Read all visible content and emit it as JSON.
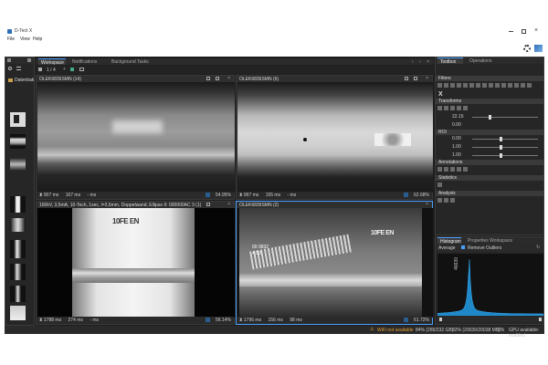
{
  "app": {
    "title": "D-Tect X"
  },
  "menu": [
    "File",
    "View",
    "Help"
  ],
  "left_panel": {
    "tab_label": "Datenbak"
  },
  "top_tabs": [
    {
      "label": "Workspace",
      "active": true
    },
    {
      "label": "Notifications",
      "active": false
    },
    {
      "label": "Background Tasks",
      "active": false
    }
  ],
  "toolbar_counter": "1 / 4",
  "viewports": [
    {
      "title": "OLEK6836SMN (14)",
      "footer": [
        "907 ms",
        "167 ms",
        "- ms"
      ],
      "zoom": "54.95%"
    },
    {
      "title": "OLEK6836SMN (6)",
      "footer": [
        "997 ms",
        "155 ms",
        "- ms"
      ],
      "zoom": "62.68%"
    },
    {
      "title": "160kV, 3,5mA, 10-Tech, 1sec, l=3,6mm, Doppelwand, Ellipse II: 000000AC 3 (1)",
      "footer": [
        "1788 ms",
        "274 ms",
        "- ms"
      ],
      "zoom": "56.14%"
    },
    {
      "title": "OLEK6836SMN (2)",
      "footer": [
        "1796 ms",
        "156 ms",
        "98 ms"
      ],
      "zoom": "61.72%"
    }
  ],
  "image_texts": {
    "iqi_a": "10FE EN",
    "iqi_b": "10FE EN",
    "ruler": [
      "00 9832",
      "4.50"
    ]
  },
  "right_tabs": [
    {
      "label": "Toolbox",
      "active": true
    },
    {
      "label": "Operations",
      "active": false
    }
  ],
  "sections": {
    "filters": "Filters",
    "transforms": "Transforms",
    "roi": "ROI",
    "annotations": "Annotations",
    "statistics": "Statistics",
    "analysis": "Analysis"
  },
  "transform_values": [
    "22.15",
    "0.00"
  ],
  "roi_values": [
    "0.00",
    "1.00",
    "1.00"
  ],
  "histogram": {
    "tabs": [
      {
        "label": "Histogram",
        "active": true
      },
      {
        "label": "Properties Workspace",
        "active": false
      }
    ],
    "mode": "Average",
    "remove_outliers": "Remove Outliers",
    "y_tick": "46630",
    "peak_position": 0.3
  },
  "status": {
    "warning": "WiFi not available",
    "mem": "84% (285/232 GB)",
    "disk": "82% (20039/20038 MB)",
    "cpu": "2%",
    "gpu": "GPU available: enabled"
  }
}
